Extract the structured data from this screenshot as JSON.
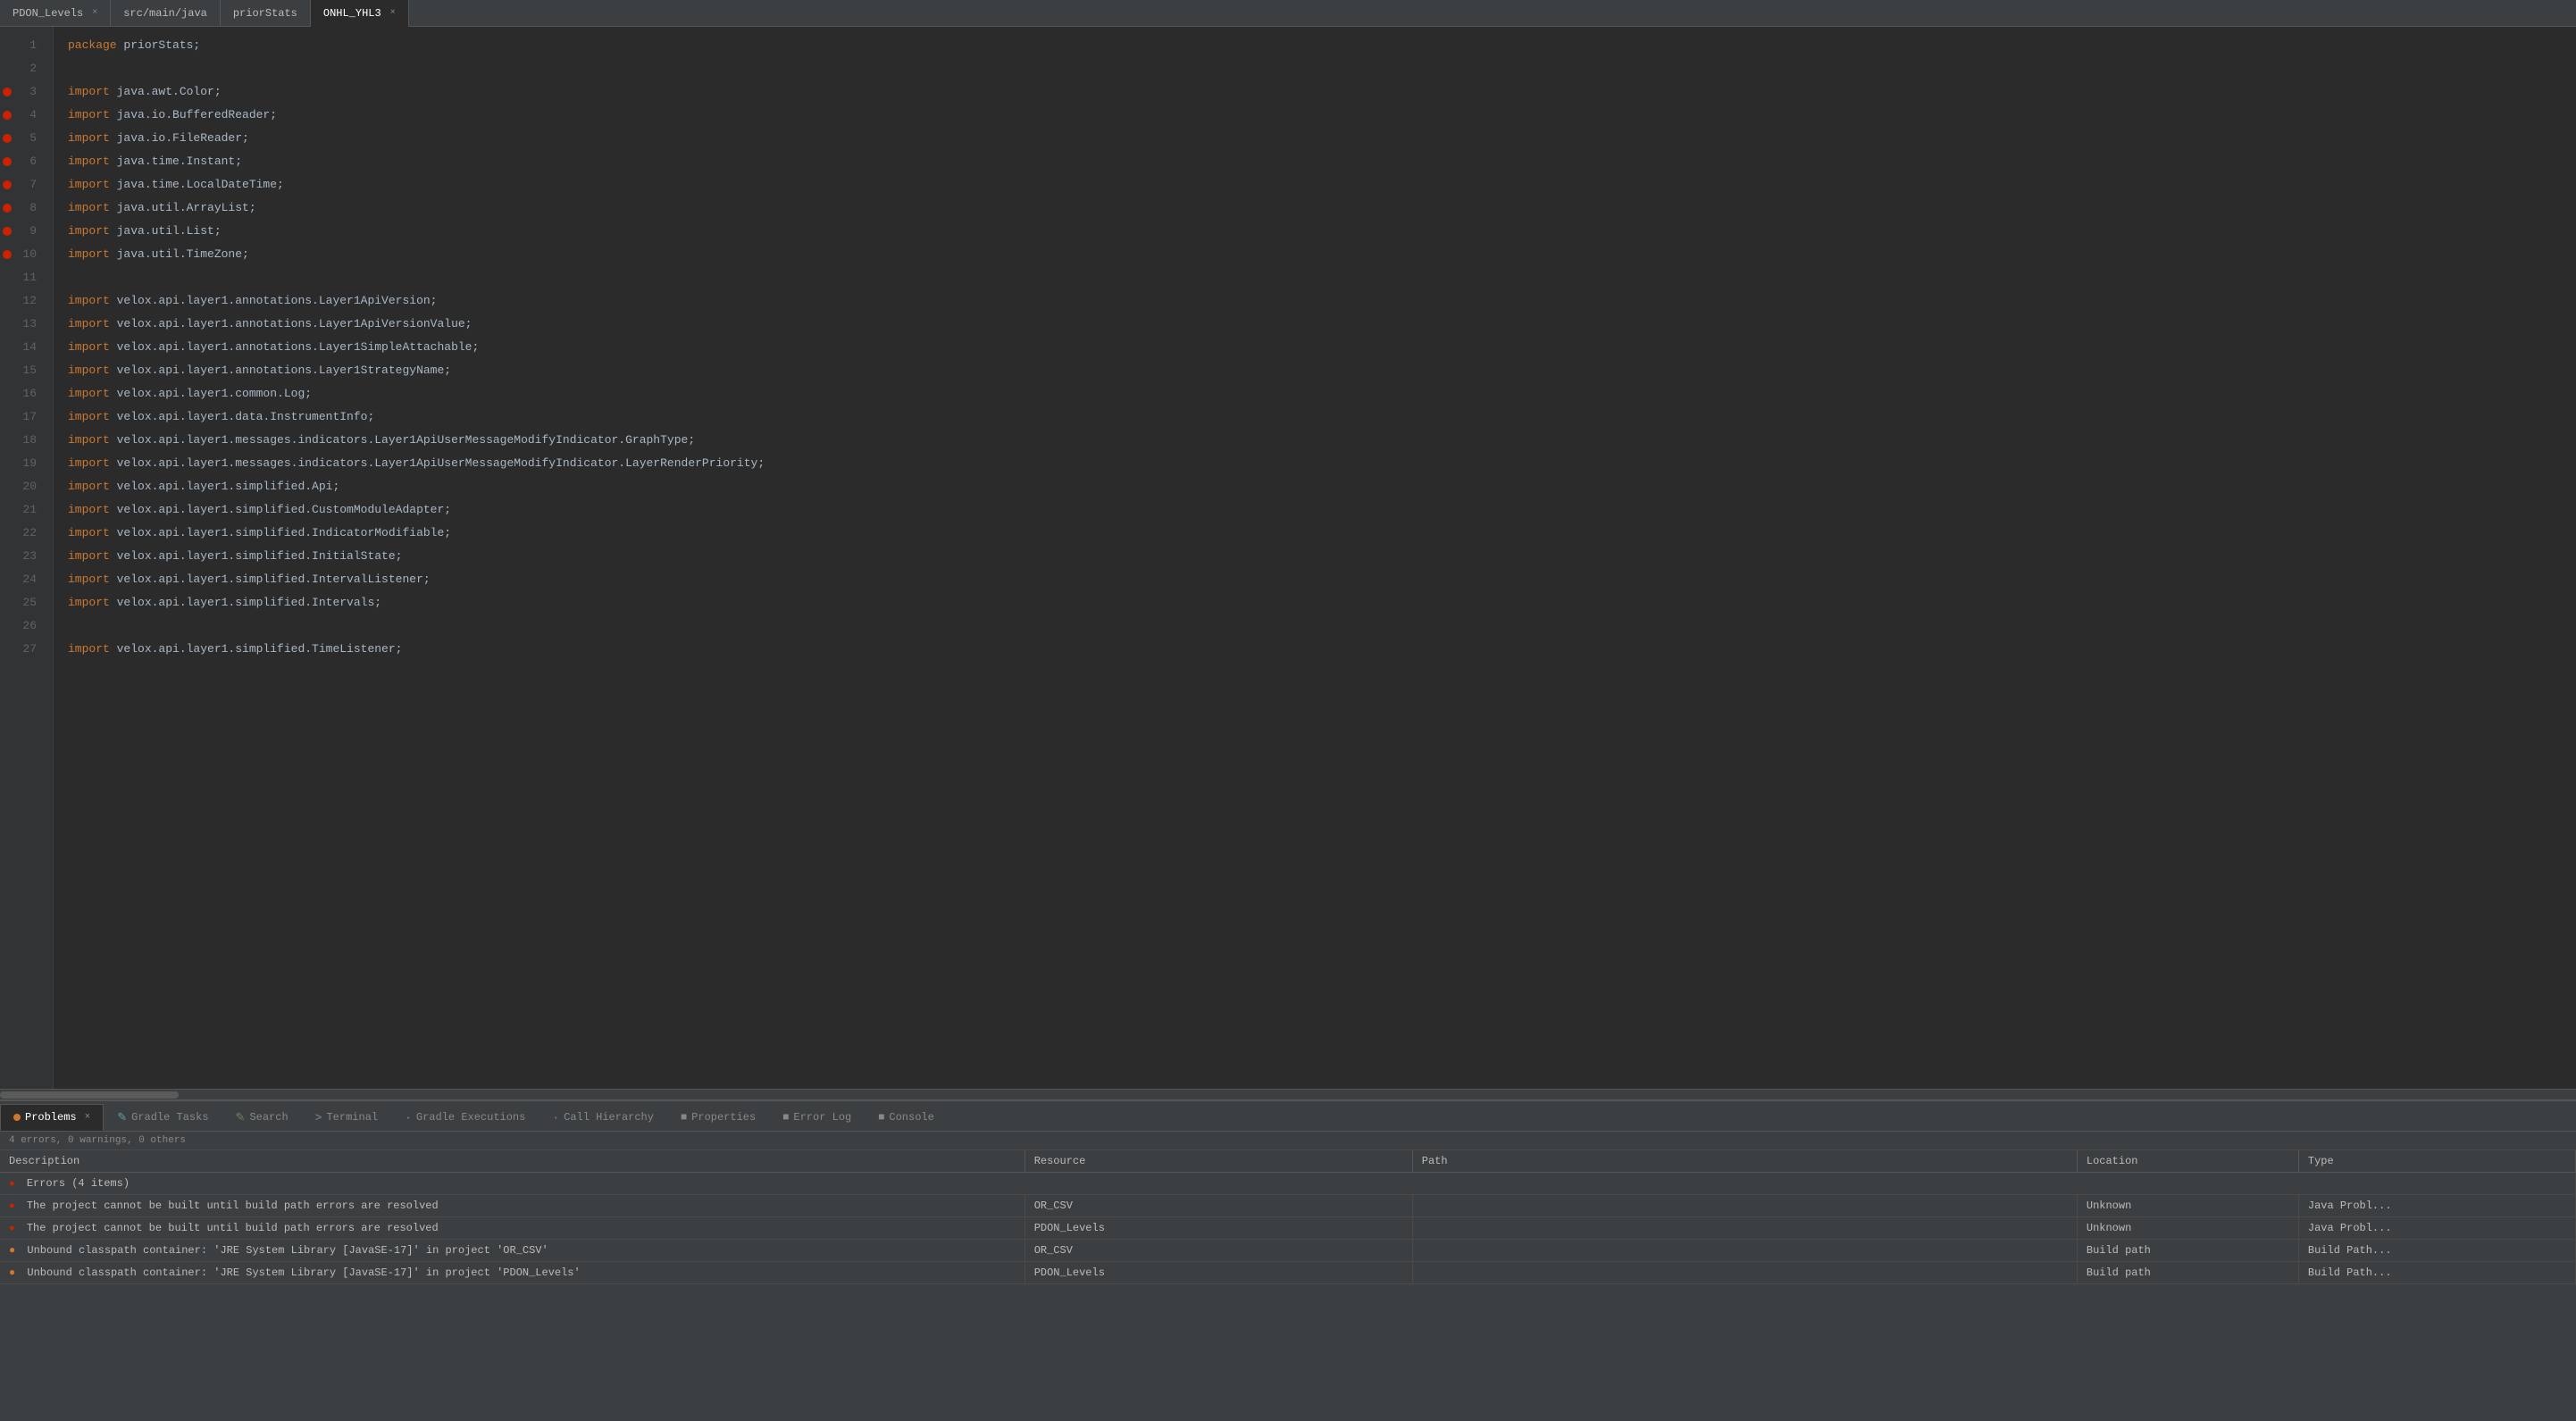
{
  "tabs": [
    {
      "label": "PDON_Levels",
      "active": false,
      "closable": true
    },
    {
      "label": "src/main/java",
      "active": false,
      "closable": false
    },
    {
      "label": "priorStats",
      "active": false,
      "closable": false
    },
    {
      "label": "ONHL_YHL3",
      "active": true,
      "closable": true
    }
  ],
  "code": {
    "lines": [
      {
        "num": 1,
        "text": "package priorStats;",
        "breakpoint": false
      },
      {
        "num": 2,
        "text": "",
        "breakpoint": false
      },
      {
        "num": 3,
        "text": "import java.awt.Color;",
        "breakpoint": true
      },
      {
        "num": 4,
        "text": "import java.io.BufferedReader;",
        "breakpoint": true
      },
      {
        "num": 5,
        "text": "import java.io.FileReader;",
        "breakpoint": true
      },
      {
        "num": 6,
        "text": "import java.time.Instant;",
        "breakpoint": true
      },
      {
        "num": 7,
        "text": "import java.time.LocalDateTime;",
        "breakpoint": true
      },
      {
        "num": 8,
        "text": "import java.util.ArrayList;",
        "breakpoint": true
      },
      {
        "num": 9,
        "text": "import java.util.List;",
        "breakpoint": true
      },
      {
        "num": 10,
        "text": "import java.util.TimeZone;",
        "breakpoint": true
      },
      {
        "num": 11,
        "text": "",
        "breakpoint": false
      },
      {
        "num": 12,
        "text": "import velox.api.layer1.annotations.Layer1ApiVersion;",
        "breakpoint": false
      },
      {
        "num": 13,
        "text": "import velox.api.layer1.annotations.Layer1ApiVersionValue;",
        "breakpoint": false
      },
      {
        "num": 14,
        "text": "import velox.api.layer1.annotations.Layer1SimpleAttachable;",
        "breakpoint": false
      },
      {
        "num": 15,
        "text": "import velox.api.layer1.annotations.Layer1StrategyName;",
        "breakpoint": false
      },
      {
        "num": 16,
        "text": "import velox.api.layer1.common.Log;",
        "breakpoint": false
      },
      {
        "num": 17,
        "text": "import velox.api.layer1.data.InstrumentInfo;",
        "breakpoint": false
      },
      {
        "num": 18,
        "text": "import velox.api.layer1.messages.indicators.Layer1ApiUserMessageModifyIndicator.GraphType;",
        "breakpoint": false
      },
      {
        "num": 19,
        "text": "import velox.api.layer1.messages.indicators.Layer1ApiUserMessageModifyIndicator.LayerRenderPriority;",
        "breakpoint": false
      },
      {
        "num": 20,
        "text": "import velox.api.layer1.simplified.Api;",
        "breakpoint": false
      },
      {
        "num": 21,
        "text": "import velox.api.layer1.simplified.CustomModuleAdapter;",
        "breakpoint": false
      },
      {
        "num": 22,
        "text": "import velox.api.layer1.simplified.IndicatorModifiable;",
        "breakpoint": false
      },
      {
        "num": 23,
        "text": "import velox.api.layer1.simplified.InitialState;",
        "breakpoint": false
      },
      {
        "num": 24,
        "text": "import velox.api.layer1.simplified.IntervalListener;",
        "breakpoint": false
      },
      {
        "num": 25,
        "text": "import velox.api.layer1.simplified.Intervals;",
        "breakpoint": false
      },
      {
        "num": 26,
        "text": "",
        "breakpoint": false
      },
      {
        "num": 27,
        "text": "import velox.api.layer1.simplified.TimeListener;",
        "breakpoint": false
      }
    ]
  },
  "bottom_panel": {
    "tabs": [
      {
        "label": "Problems",
        "active": true,
        "dot_class": "tab-dot",
        "marker": "×"
      },
      {
        "label": "Gradle Tasks",
        "active": false,
        "dot_class": "tab-dot-blue",
        "marker": "✎"
      },
      {
        "label": "Search",
        "active": false,
        "dot_class": "tab-dot-green",
        "marker": "✎"
      },
      {
        "label": "Terminal",
        "active": false,
        "dot_class": "tab-dot-gray",
        "marker": ">"
      },
      {
        "label": "Gradle Executions",
        "active": false,
        "dot_class": "tab-dot-blue",
        "marker": "·"
      },
      {
        "label": "Call Hierarchy",
        "active": false,
        "dot_class": "tab-dot-purple",
        "marker": "·"
      },
      {
        "label": "Properties",
        "active": false,
        "dot_class": "tab-dot-gray",
        "marker": "■"
      },
      {
        "label": "Error Log",
        "active": false,
        "dot_class": "tab-dot-gray",
        "marker": "■"
      },
      {
        "label": "Console",
        "active": false,
        "dot_class": "tab-dot-gray",
        "marker": "■"
      }
    ],
    "summary": "4 errors, 0 warnings, 0 others",
    "columns": [
      "Description",
      "Resource",
      "Path",
      "Location",
      "Type"
    ],
    "error_group": "Errors (4 items)",
    "rows": [
      {
        "description": "The project cannot be built until build path errors are resolved",
        "resource": "OR_CSV",
        "path": "",
        "location": "Unknown",
        "type": "Java Probl..."
      },
      {
        "description": "The project cannot be built until build path errors are resolved",
        "resource": "PDON_Levels",
        "path": "",
        "location": "Unknown",
        "type": "Java Probl..."
      },
      {
        "description": "Unbound classpath container: 'JRE System Library [JavaSE-17]' in project 'OR_CSV'",
        "resource": "OR_CSV",
        "path": "",
        "location": "Build path",
        "type": "Build Path..."
      },
      {
        "description": "Unbound classpath container: 'JRE System Library [JavaSE-17]' in project 'PDON_Levels'",
        "resource": "PDON_Levels",
        "path": "",
        "location": "Build path",
        "type": "Build Path..."
      }
    ]
  }
}
